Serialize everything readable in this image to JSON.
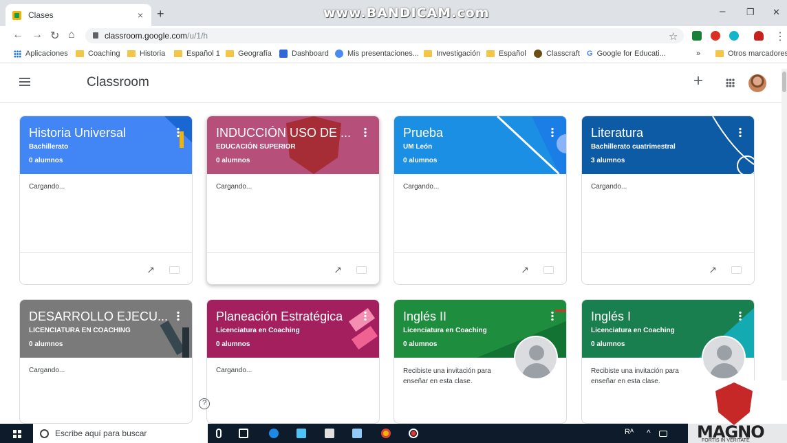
{
  "browser": {
    "tab_title": "Clases",
    "tab_close": "×",
    "new_tab": "+",
    "watermark": "www.BANDICAM.com",
    "url_host": "classroom.google.com",
    "url_path": "/u/1/h",
    "win_min": "–",
    "win_max": "❐",
    "win_close": "✕",
    "back": "←",
    "forward": "→",
    "reload": "↻",
    "home": "⌂",
    "star": "☆",
    "menu": "⋮"
  },
  "bookmarks": {
    "items": [
      "Aplicaciones",
      "Coaching",
      "Historia",
      "Español 1",
      "Geografía",
      "Dashboard",
      "Mis presentaciones...",
      "Investigación",
      "Español",
      "Classcraft",
      "Google for Educati..."
    ],
    "more": "»",
    "other": "Otros marcadores"
  },
  "app": {
    "name": "Classroom",
    "create_icon": "+",
    "colors": {
      "blue": "#4285f4",
      "pink": "#b64f7a",
      "teal_blue": "#1a8fe3",
      "navy": "#0d5aa5",
      "gray": "#7a7a7a",
      "magenta": "#a41f5e",
      "green": "#1e8e3e",
      "green2": "#1a7f4e"
    }
  },
  "classes": [
    {
      "title": "Historia Universal",
      "section": "Bachillerato",
      "students": "0 alumnos",
      "status": "Cargando..."
    },
    {
      "title": "INDUCCIÓN USO DE ...",
      "section": "EDUCACIÓN SUPERIOR",
      "students": "0 alumnos",
      "status": "Cargando..."
    },
    {
      "title": "Prueba",
      "section": "UM León",
      "students": "0 alumnos",
      "status": "Cargando..."
    },
    {
      "title": "Literatura",
      "section": "Bachillerato cuatrimestral",
      "students": "3 alumnos",
      "status": "Cargando..."
    },
    {
      "title": "DESARROLLO EJECU...",
      "section": "LICENCIATURA EN COACHING",
      "students": "0 alumnos",
      "status": "Cargando..."
    },
    {
      "title": "Planeación Estratégica",
      "section": "Licenciatura en Coaching",
      "students": "0 alumnos",
      "status": "Cargando..."
    },
    {
      "title": "Inglés II",
      "section": "Licenciatura en Coaching",
      "students": "0 alumnos",
      "status": "Recibiste una invitación para enseñar en esta clase."
    },
    {
      "title": "Inglés I",
      "section": "Licenciatura en Coaching",
      "students": "0 alumnos",
      "status": "Recibiste una invitación para enseñar en esta clase."
    }
  ],
  "footer_icons": {
    "trend": "↗"
  },
  "help": "?",
  "taskbar": {
    "search_placeholder": "Escribe aquí para buscar",
    "tray_lang": "Rᴬ",
    "tray_up": "^"
  },
  "overlay": {
    "logo_word": "MAGNO",
    "logo_motto": "FORTIS IN VERITATE"
  }
}
